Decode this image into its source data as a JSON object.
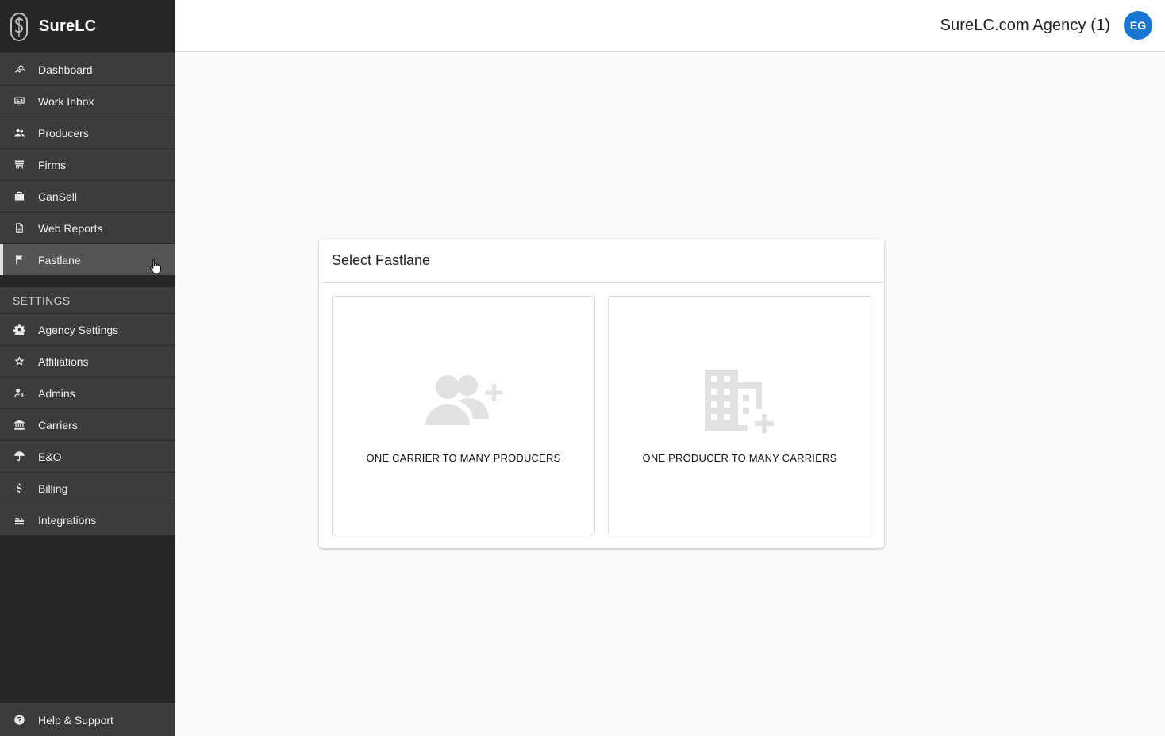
{
  "brand": {
    "name": "SureLC"
  },
  "sidebar": {
    "items": [
      {
        "label": "Dashboard",
        "icon": "dashboard-icon"
      },
      {
        "label": "Work Inbox",
        "icon": "work-inbox-icon"
      },
      {
        "label": "Producers",
        "icon": "producers-icon"
      },
      {
        "label": "Firms",
        "icon": "firms-icon"
      },
      {
        "label": "CanSell",
        "icon": "cansell-icon"
      },
      {
        "label": "Web Reports",
        "icon": "web-reports-icon"
      },
      {
        "label": "Fastlane",
        "icon": "flag-icon",
        "active": true
      }
    ],
    "settings_header": "SETTINGS",
    "settings_items": [
      {
        "label": "Agency Settings",
        "icon": "gear-icon"
      },
      {
        "label": "Affiliations",
        "icon": "star-icon"
      },
      {
        "label": "Admins",
        "icon": "admin-icon"
      },
      {
        "label": "Carriers",
        "icon": "bank-icon"
      },
      {
        "label": "E&O",
        "icon": "umbrella-icon"
      },
      {
        "label": "Billing",
        "icon": "dollar-icon"
      },
      {
        "label": "Integrations",
        "icon": "integrations-icon"
      }
    ],
    "help_label": "Help & Support"
  },
  "header": {
    "agency_name": "SureLC.com Agency (1)",
    "avatar_initials": "EG",
    "avatar_color": "#1976d2"
  },
  "main": {
    "card_title": "Select Fastlane",
    "options": [
      {
        "label": "ONE CARRIER TO MANY PRODUCERS",
        "icon": "group-add-icon"
      },
      {
        "label": "ONE PRODUCER TO MANY CARRIERS",
        "icon": "domain-add-icon"
      }
    ]
  }
}
